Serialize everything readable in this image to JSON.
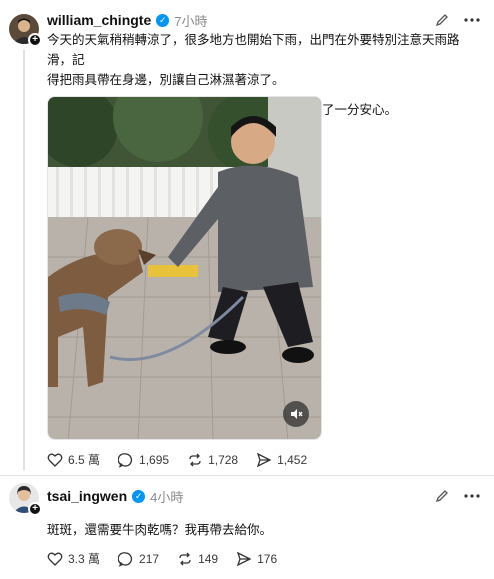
{
  "posts": [
    {
      "username": "william_chingte",
      "time": "7小時",
      "paragraphs": [
        "今天的天氣稍稍轉涼了，很多地方也開始下雨，出門在外要特別注意天雨路滑，記",
        "得把雨具帶在身邊，別讓自己淋濕著涼了。",
        "出門前那一眼的守候，總讓人多了一點牽掛，也多了一分安心。"
      ],
      "stats": {
        "likes": "6.5 萬",
        "comments": "1,695",
        "reposts": "1,728",
        "shares": "1,452"
      },
      "avatar_icon": "person-avatar",
      "media": "photo-man-petting-dog"
    },
    {
      "username": "tsai_ingwen",
      "time": "4小時",
      "paragraphs": [
        "斑斑，還需要牛肉乾嗎？我再帶去給你。"
      ],
      "stats": {
        "likes": "3.3 萬",
        "comments": "217",
        "reposts": "149",
        "shares": "176"
      },
      "avatar_icon": "person-avatar"
    }
  ],
  "colors": {
    "verified": "#0095f6",
    "text": "#101010",
    "muted": "#8a8a8a"
  }
}
